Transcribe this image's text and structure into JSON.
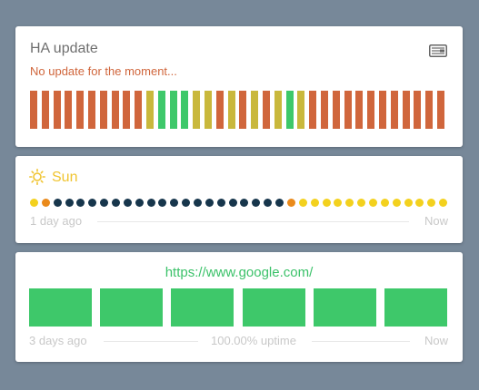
{
  "colors": {
    "background": "#778899",
    "red": "#d0663c",
    "yellow": "#c9b83c",
    "green": "#3ec86a",
    "sun_up": "#f3d11e",
    "sun_down": "#17364c",
    "sun_transition": "#ea8a1b"
  },
  "ha_update": {
    "title": "HA update",
    "status": "No update for the moment...",
    "icon": "server-icon",
    "bars": [
      "red",
      "red",
      "red",
      "red",
      "red",
      "red",
      "red",
      "red",
      "red",
      "red",
      "yellow",
      "green",
      "green",
      "green",
      "yellow",
      "yellow",
      "red",
      "yellow",
      "red",
      "yellow",
      "red",
      "yellow",
      "green",
      "yellow",
      "red",
      "red",
      "red",
      "red",
      "red",
      "red",
      "red",
      "red",
      "red",
      "red",
      "red",
      "red"
    ]
  },
  "sun": {
    "title": "Sun",
    "icon": "sun-icon",
    "dots": [
      "up",
      "transition",
      "down",
      "down",
      "down",
      "down",
      "down",
      "down",
      "down",
      "down",
      "down",
      "down",
      "down",
      "down",
      "down",
      "down",
      "down",
      "down",
      "down",
      "down",
      "down",
      "down",
      "transition",
      "up",
      "up",
      "up",
      "up",
      "up",
      "up",
      "up",
      "up",
      "up",
      "up",
      "up",
      "up",
      "up"
    ],
    "start_label": "1 day ago",
    "end_label": "Now"
  },
  "uptime": {
    "url": "https://www.google.com/",
    "bars": [
      "green",
      "green",
      "green",
      "green",
      "green",
      "green"
    ],
    "start_label": "3 days ago",
    "middle_label": "100.00% uptime",
    "end_label": "Now"
  }
}
